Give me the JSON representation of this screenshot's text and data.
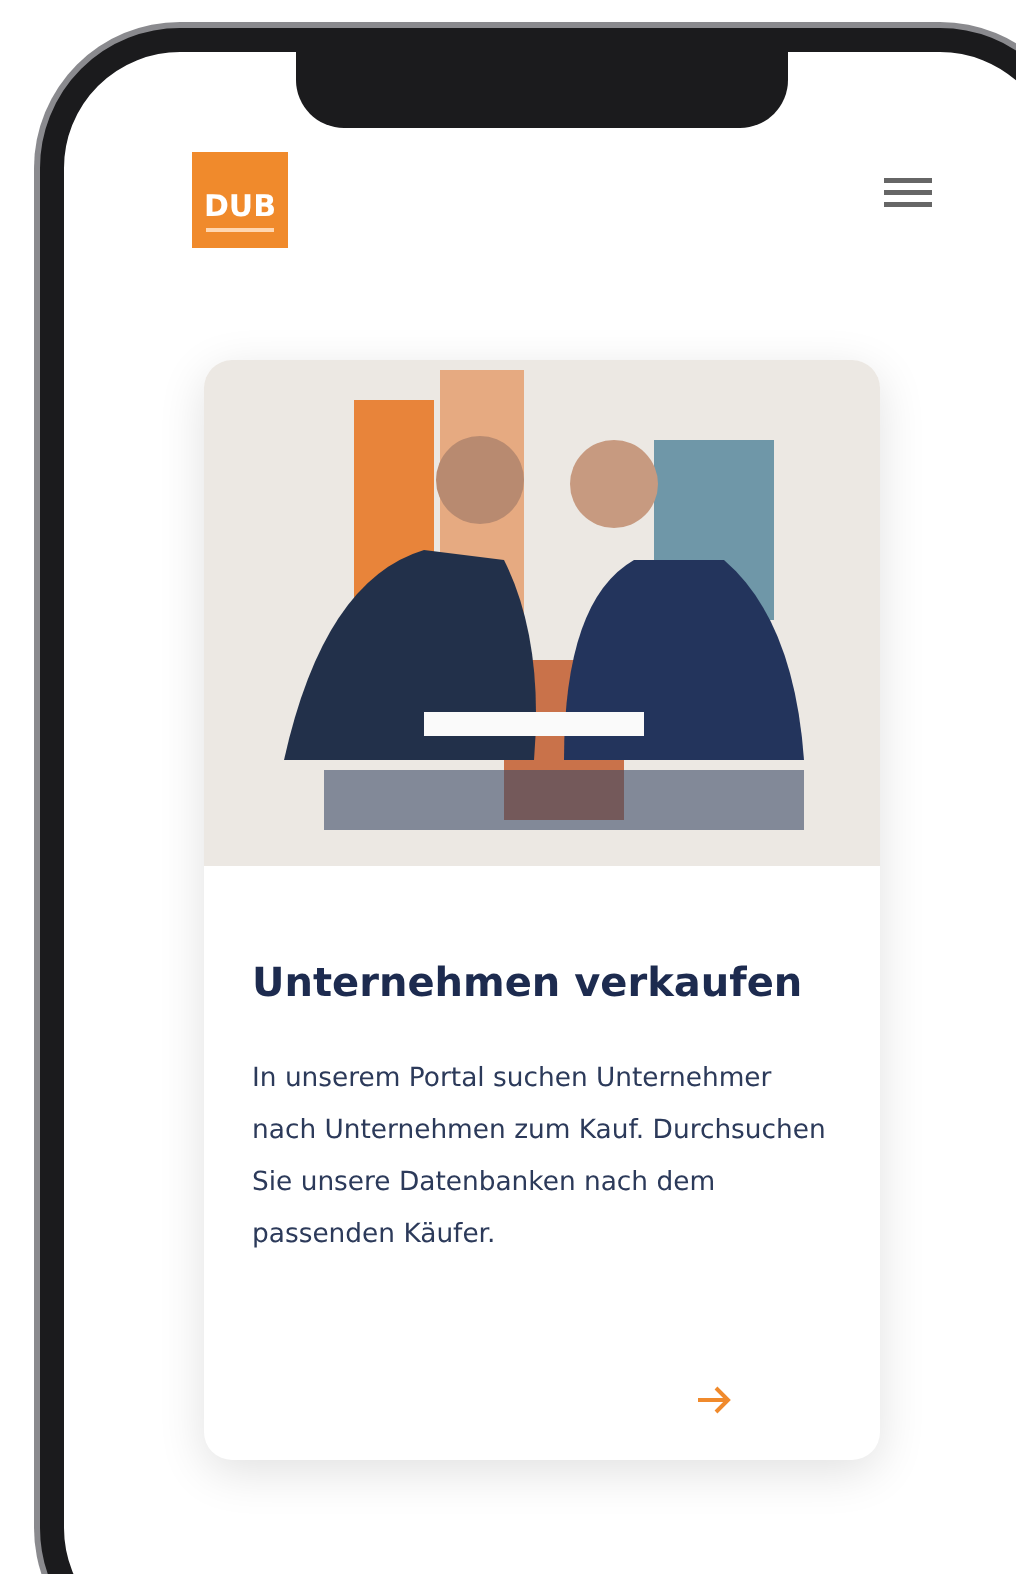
{
  "header": {
    "logo": "DUB"
  },
  "card": {
    "title": "Unternehmen verkaufen",
    "text": "In unserem Portal suchen Unternehmer nach Unternehmen zum Kauf. Durchsuchen Sie unsere Datenbanken nach dem passenden Käufer."
  }
}
